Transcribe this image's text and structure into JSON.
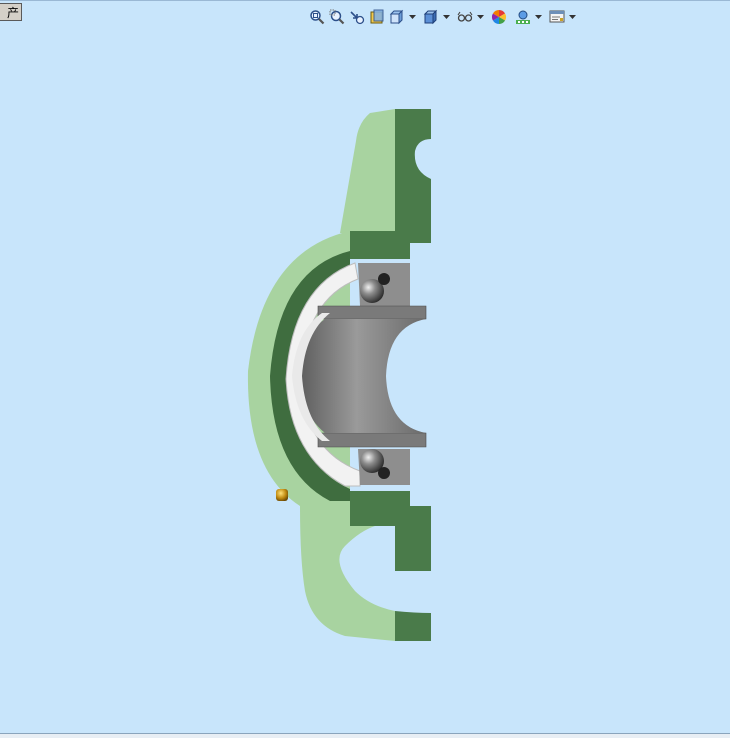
{
  "document_tab": {
    "label": "产品"
  },
  "toolbar": {
    "items": [
      {
        "icon": "zoom-to-fit-icon"
      },
      {
        "icon": "zoom-to-area-icon"
      },
      {
        "icon": "previous-view-icon"
      },
      {
        "icon": "section-view-icon"
      },
      {
        "icon": "view-orientation-icon",
        "has_dropdown": true
      },
      {
        "icon": "display-style-icon",
        "has_dropdown": true
      },
      {
        "icon": "hide-show-items-icon",
        "has_dropdown": true
      },
      {
        "icon": "edit-appearance-icon"
      },
      {
        "icon": "apply-scene-icon",
        "has_dropdown": true
      },
      {
        "icon": "view-settings-icon",
        "has_dropdown": true
      }
    ]
  },
  "model": {
    "description_colors": {
      "housing_light": "#a9d4a0",
      "housing_dark": "#4a7a4a",
      "bearing_steel": "#8a8a8a",
      "sky": "#c8e5fb"
    }
  }
}
